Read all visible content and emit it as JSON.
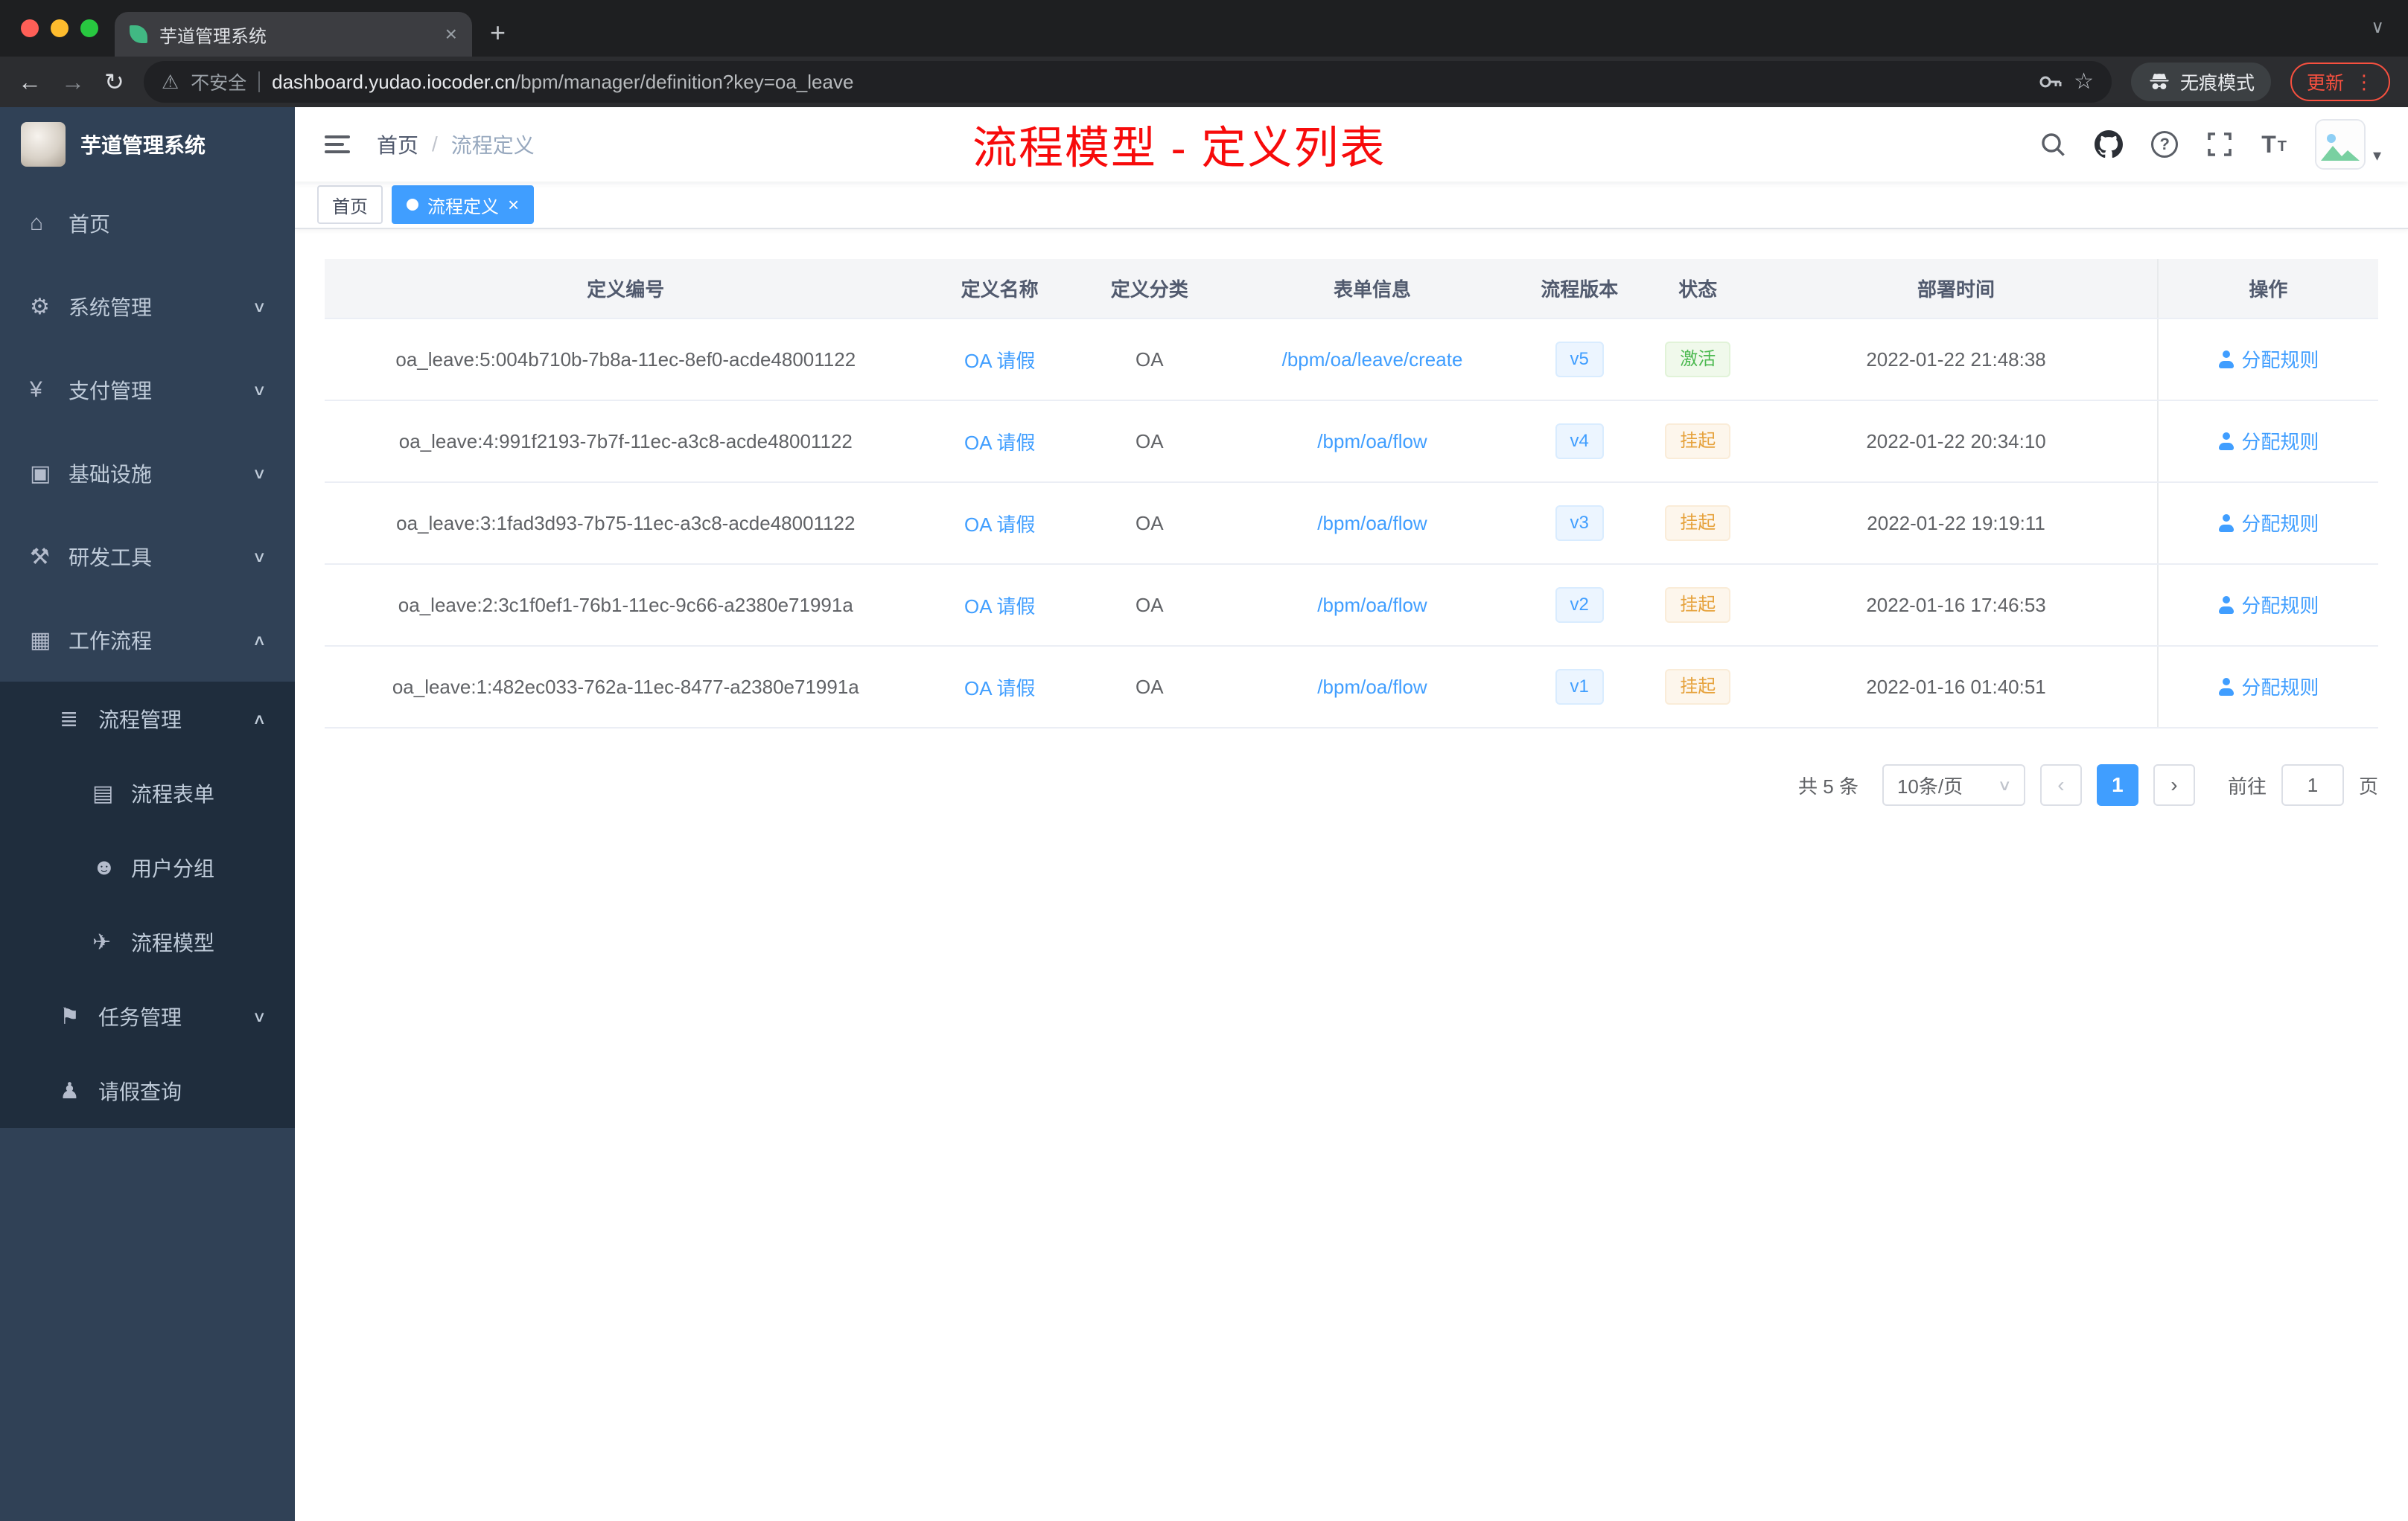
{
  "browser": {
    "tab_title": "芋道管理系统",
    "address": {
      "security_label": "不安全",
      "domain": "dashboard.yudao.iocoder.cn",
      "path": "/bpm/manager/definition?key=oa_leave"
    },
    "incognito_label": "无痕模式",
    "update_label": "更新"
  },
  "sidebar": {
    "logo_title": "芋道管理系统",
    "items": [
      {
        "key": "home",
        "label": "首页",
        "icon": "home",
        "level": 0,
        "chevron": null
      },
      {
        "key": "system-management",
        "label": "系统管理",
        "icon": "gear",
        "level": 0,
        "chevron": "down"
      },
      {
        "key": "payment-management",
        "label": "支付管理",
        "icon": "yuan",
        "level": 0,
        "chevron": "down"
      },
      {
        "key": "infrastructure",
        "label": "基础设施",
        "icon": "monitor",
        "level": 0,
        "chevron": "down"
      },
      {
        "key": "dev-tools",
        "label": "研发工具",
        "icon": "tools",
        "level": 0,
        "chevron": "down"
      },
      {
        "key": "workflow",
        "label": "工作流程",
        "icon": "briefcase",
        "level": 0,
        "chevron": "up"
      },
      {
        "key": "process-management",
        "label": "流程管理",
        "icon": "list",
        "level": 1,
        "chevron": "up"
      },
      {
        "key": "process-form",
        "label": "流程表单",
        "icon": "form",
        "level": 2,
        "chevron": null
      },
      {
        "key": "user-group",
        "label": "用户分组",
        "icon": "users",
        "level": 2,
        "chevron": null
      },
      {
        "key": "process-model",
        "label": "流程模型",
        "icon": "plane",
        "level": 2,
        "chevron": null
      },
      {
        "key": "task-management",
        "label": "任务管理",
        "icon": "flag",
        "level": 1,
        "chevron": "down"
      },
      {
        "key": "leave-query",
        "label": "请假查询",
        "icon": "user",
        "level": 1,
        "chevron": null
      }
    ]
  },
  "header": {
    "breadcrumb": {
      "home": "首页",
      "separator": "/",
      "current": "流程定义"
    },
    "annotation": "流程模型 - 定义列表"
  },
  "tags": {
    "items": [
      {
        "label": "首页",
        "active": false
      },
      {
        "label": "流程定义",
        "active": true
      }
    ]
  },
  "table": {
    "columns": [
      {
        "key": "definition-id",
        "label": "定义编号"
      },
      {
        "key": "definition-name",
        "label": "定义名称"
      },
      {
        "key": "definition-category",
        "label": "定义分类"
      },
      {
        "key": "form-info",
        "label": "表单信息"
      },
      {
        "key": "process-version",
        "label": "流程版本"
      },
      {
        "key": "status",
        "label": "状态"
      },
      {
        "key": "deploy-time",
        "label": "部署时间"
      },
      {
        "key": "actions",
        "label": "操作"
      }
    ],
    "rows": [
      {
        "id": "oa_leave:5:004b710b-7b8a-11ec-8ef0-acde48001122",
        "name": "OA 请假",
        "category": "OA",
        "form": "/bpm/oa/leave/create",
        "version": "v5",
        "status": {
          "label": "激活",
          "type": "success"
        },
        "deploy_time": "2022-01-22 21:48:38",
        "action": "分配规则"
      },
      {
        "id": "oa_leave:4:991f2193-7b7f-11ec-a3c8-acde48001122",
        "name": "OA 请假",
        "category": "OA",
        "form": "/bpm/oa/flow",
        "version": "v4",
        "status": {
          "label": "挂起",
          "type": "warning"
        },
        "deploy_time": "2022-01-22 20:34:10",
        "action": "分配规则"
      },
      {
        "id": "oa_leave:3:1fad3d93-7b75-11ec-a3c8-acde48001122",
        "name": "OA 请假",
        "category": "OA",
        "form": "/bpm/oa/flow",
        "version": "v3",
        "status": {
          "label": "挂起",
          "type": "warning"
        },
        "deploy_time": "2022-01-22 19:19:11",
        "action": "分配规则"
      },
      {
        "id": "oa_leave:2:3c1f0ef1-76b1-11ec-9c66-a2380e71991a",
        "name": "OA 请假",
        "category": "OA",
        "form": "/bpm/oa/flow",
        "version": "v2",
        "status": {
          "label": "挂起",
          "type": "warning"
        },
        "deploy_time": "2022-01-16 17:46:53",
        "action": "分配规则"
      },
      {
        "id": "oa_leave:1:482ec033-762a-11ec-8477-a2380e71991a",
        "name": "OA 请假",
        "category": "OA",
        "form": "/bpm/oa/flow",
        "version": "v1",
        "status": {
          "label": "挂起",
          "type": "warning"
        },
        "deploy_time": "2022-01-16 01:40:51",
        "action": "分配规则"
      }
    ]
  },
  "pagination": {
    "total_label": "共 5 条",
    "page_size": "10条/页",
    "current_page": "1",
    "goto_label": "前往",
    "goto_value": "1",
    "page_unit": "页"
  },
  "icons": {
    "home": "⌂",
    "gear": "⚙",
    "yuan": "¥",
    "monitor": "▣",
    "tools": "⚒",
    "briefcase": "▦",
    "list": "≣",
    "form": "▤",
    "users": "☻",
    "plane": "✈",
    "flag": "⚑",
    "user": "♟",
    "chevron_down": "∨",
    "chevron_up": "∧",
    "close": "×",
    "plus": "+",
    "back": "←",
    "forward": "→",
    "reload": "↻",
    "warning": "⚠",
    "star": "☆",
    "kebab": "⋮",
    "question": "?",
    "letter_T": "T",
    "caret_down": "▾",
    "select_caret": "∨",
    "prev": "‹",
    "next": "›"
  },
  "colors": {
    "accent_blue": "#409eff",
    "annotation_red": "#f70b0b",
    "sidebar_bg": "#304156",
    "submenu_bg": "#1f2d3d",
    "success_green": "#4cb950",
    "warning_orange": "#e6a23c",
    "update_red": "#f8503f"
  }
}
